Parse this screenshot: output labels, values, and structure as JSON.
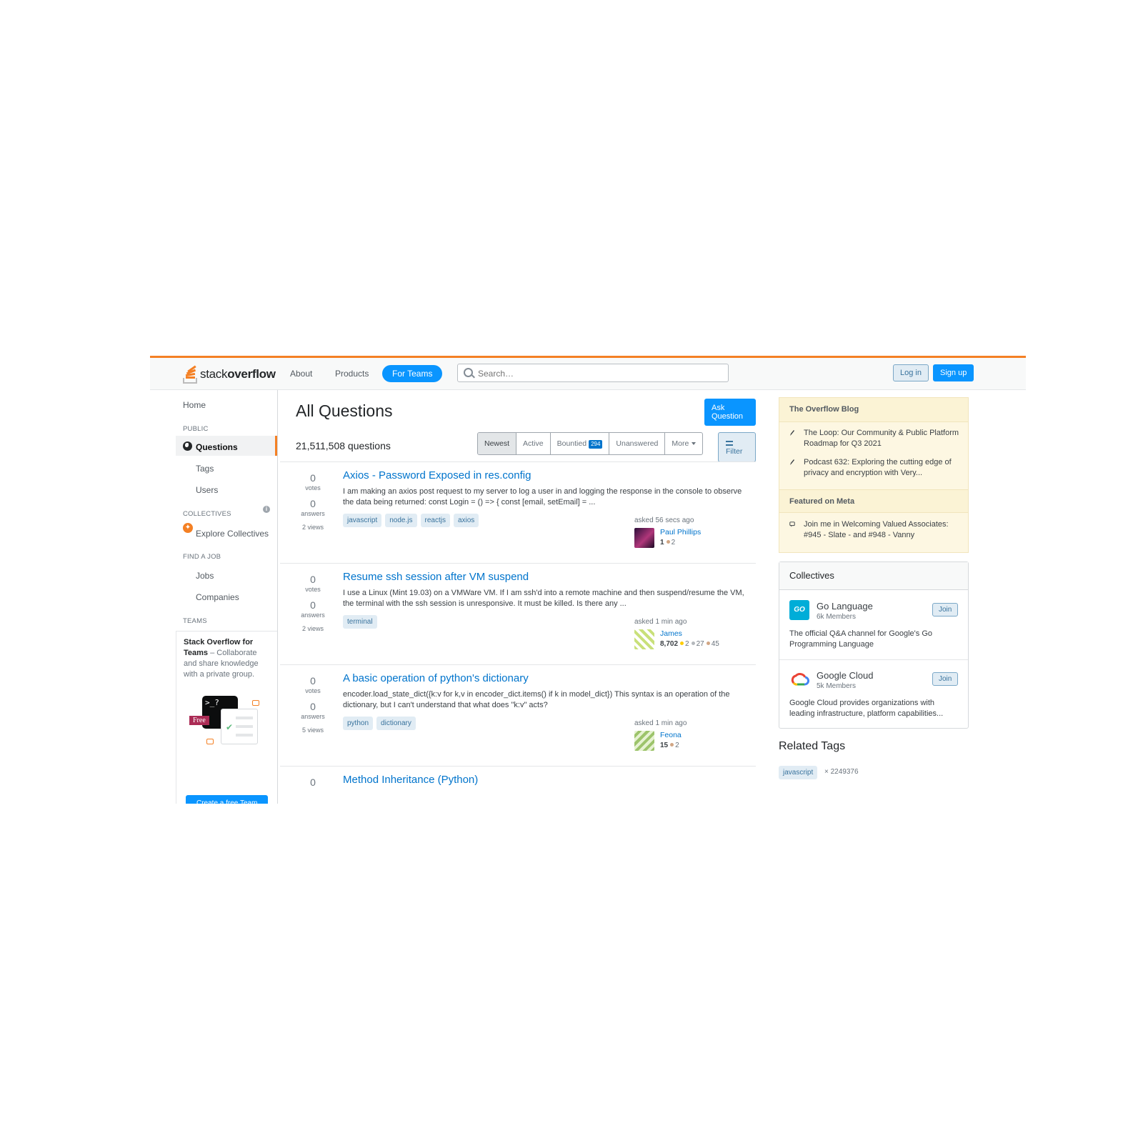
{
  "header": {
    "logo_plain": "stack",
    "logo_bold": "overflow",
    "nav": [
      "About",
      "Products",
      "For Teams"
    ],
    "search_placeholder": "Search…",
    "login": "Log in",
    "signup": "Sign up"
  },
  "sidebar": {
    "home": "Home",
    "public_heading": "PUBLIC",
    "questions": "Questions",
    "tags": "Tags",
    "users": "Users",
    "collectives_heading": "COLLECTIVES",
    "explore_collectives": "Explore Collectives",
    "find_job_heading": "FIND A JOB",
    "jobs": "Jobs",
    "companies": "Companies",
    "teams_heading": "TEAMS",
    "teams_title": "Stack Overflow for Teams",
    "teams_body": " – Collaborate and share knowledge with a private group.",
    "free_badge": "Free",
    "terminal_text": ">_?",
    "create_team": "Create a free Team"
  },
  "main": {
    "title": "All Questions",
    "ask_button": "Ask Question",
    "count": "21,511,508 questions",
    "filters": {
      "newest": "Newest",
      "active": "Active",
      "bountied": "Bountied",
      "bountied_count": "294",
      "unanswered": "Unanswered",
      "more": "More"
    },
    "filter_button": "Filter",
    "questions": [
      {
        "votes": "0",
        "votes_label": "votes",
        "answers": "0",
        "answers_label": "answers",
        "views": "2 views",
        "title": "Axios - Password Exposed in res.config",
        "excerpt": "I am making an axios post request to my server to log a user in and logging the response in the console to observe the data being returned: const Login = () => { const [email, setEmail] = ...",
        "tags": [
          "javascript",
          "node.js",
          "reactjs",
          "axios"
        ],
        "asked": "asked 56 secs ago",
        "user": "Paul Phillips",
        "rep": "1",
        "badges": [
          "2"
        ],
        "avatar_color": "#5a2a6a"
      },
      {
        "votes": "0",
        "votes_label": "votes",
        "answers": "0",
        "answers_label": "answers",
        "views": "2 views",
        "title": "Resume ssh session after VM suspend",
        "excerpt": "I use a Linux (Mint 19.03) on a VMWare VM. If I am ssh'd into a remote machine and then suspend/resume the VM, the terminal with the ssh session is unresponsive. It must be killed. Is there any ...",
        "tags": [
          "terminal"
        ],
        "asked": "asked 1 min ago",
        "user": "James",
        "rep": "8,702",
        "badges": [
          "2",
          "27",
          "45"
        ],
        "avatar_color": "#9acd32"
      },
      {
        "votes": "0",
        "votes_label": "votes",
        "answers": "0",
        "answers_label": "answers",
        "views": "5 views",
        "title": "A basic operation of python's dictionary",
        "excerpt": "encoder.load_state_dict({k:v for k,v in encoder_dict.items() if k in model_dict}) This syntax is an operation of the dictionary, but I can't understand that what does \"k:v\" acts?",
        "tags": [
          "python",
          "dictionary"
        ],
        "asked": "asked 1 min ago",
        "user": "Feona",
        "rep": "15",
        "badges": [
          "2"
        ],
        "avatar_color": "#8fbc5a"
      },
      {
        "votes": "0",
        "votes_label": "votes",
        "answers": "",
        "answers_label": "",
        "views": "",
        "title": "Method Inheritance (Python)",
        "excerpt": "",
        "tags": [],
        "asked": "",
        "user": "",
        "rep": "",
        "badges": [],
        "avatar_color": "#ffffff"
      }
    ]
  },
  "right": {
    "blog_heading": "The Overflow Blog",
    "blog_items": [
      "The Loop: Our Community & Public Platform Roadmap for Q3 2021",
      "Podcast 632: Exploring the cutting edge of privacy and encryption with Very..."
    ],
    "meta_heading": "Featured on Meta",
    "meta_items": [
      "Join me in Welcoming Valued Associates: #945 - Slate - and #948 - Vanny"
    ],
    "collectives_heading": "Collectives",
    "collectives": [
      {
        "name": "Go Language",
        "members": "6k Members",
        "desc": "The official Q&A channel for Google's Go Programming Language",
        "join": "Join",
        "logo": "GO"
      },
      {
        "name": "Google Cloud",
        "members": "5k Members",
        "desc": "Google Cloud provides organizations with leading infrastructure, platform capabilities...",
        "join": "Join",
        "logo": ""
      }
    ],
    "related_heading": "Related Tags",
    "related_tag": "javascript",
    "related_count": "× 2249376"
  },
  "colors": {
    "accent": "#f48024",
    "link": "#0074cc",
    "primary_button": "#0a95ff",
    "tag_bg": "#e1ecf4"
  },
  "icons": [
    "search-icon",
    "globe-icon",
    "collectives-star-icon",
    "info-icon",
    "pen-icon",
    "meta-icon",
    "filter-icon",
    "caret-down-icon",
    "google-cloud-logo"
  ]
}
